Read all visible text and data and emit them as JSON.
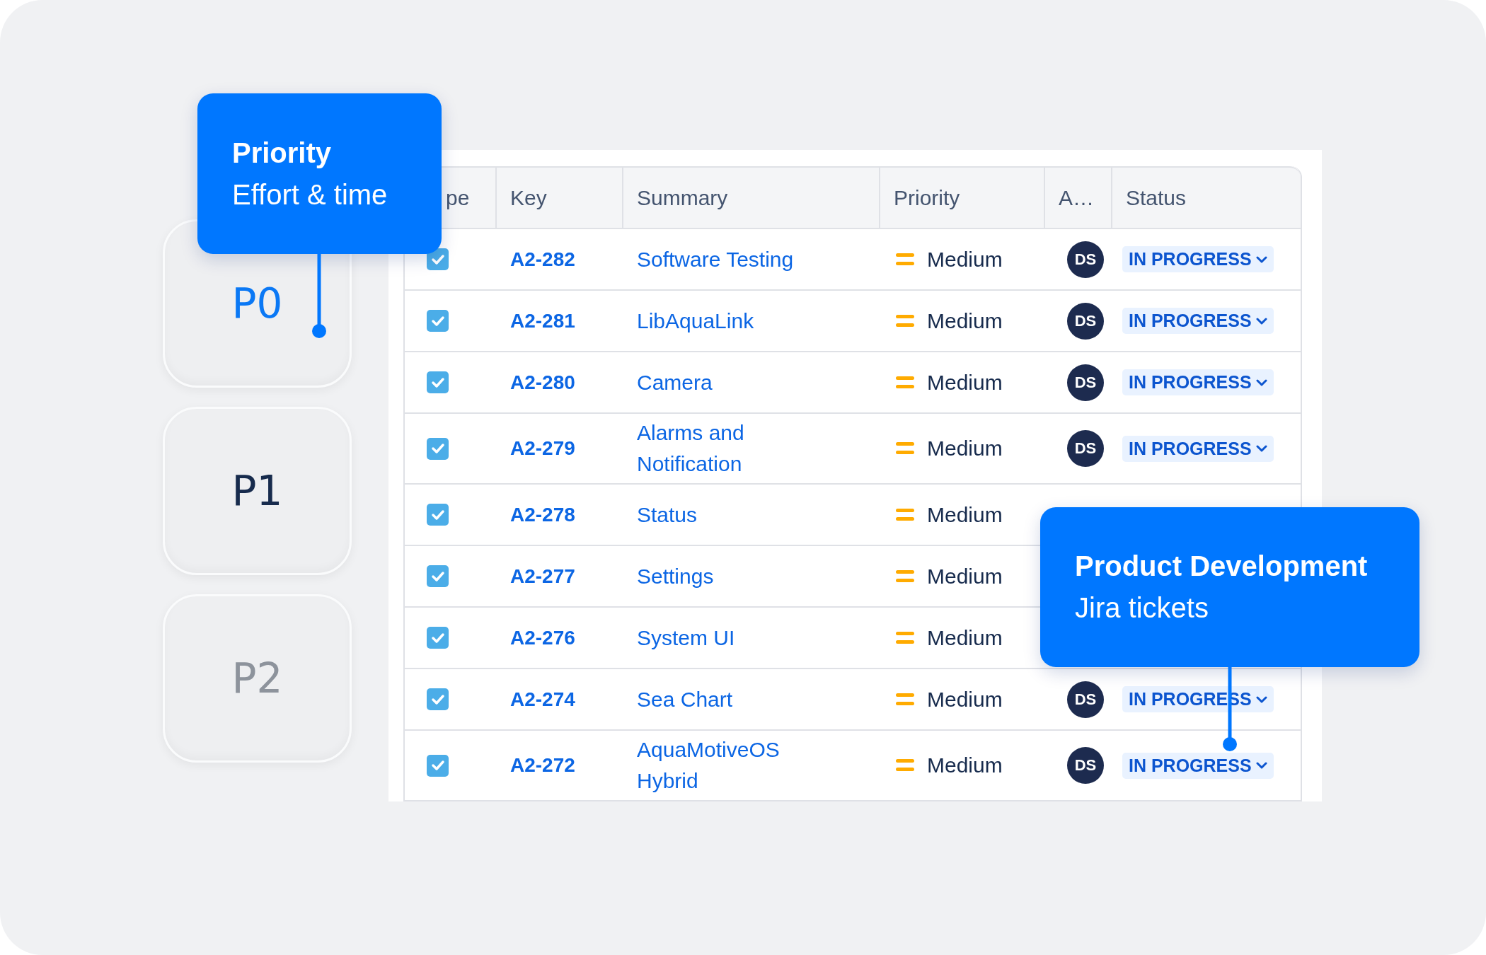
{
  "priority_cards": [
    {
      "label": "P0",
      "color": "#0a78f5"
    },
    {
      "label": "P1",
      "color": "#172b4d"
    },
    {
      "label": "P2",
      "color": "#8d939c"
    }
  ],
  "table": {
    "columns": [
      "pe",
      "Key",
      "Summary",
      "Priority",
      "A…",
      "Status"
    ],
    "rows": [
      {
        "checked": true,
        "key": "A2-282",
        "summary": "Software Testing",
        "priority": "Medium",
        "assignee": "DS",
        "status": "IN PROGRESS"
      },
      {
        "checked": true,
        "key": "A2-281",
        "summary": "LibAquaLink",
        "priority": "Medium",
        "assignee": "DS",
        "status": "IN PROGRESS"
      },
      {
        "checked": true,
        "key": "A2-280",
        "summary": "Camera",
        "priority": "Medium",
        "assignee": "DS",
        "status": "IN PROGRESS"
      },
      {
        "checked": true,
        "key": "A2-279",
        "summary": "Alarms and Notification",
        "priority": "Medium",
        "assignee": "DS",
        "status": "IN PROGRESS"
      },
      {
        "checked": true,
        "key": "A2-278",
        "summary": "Status",
        "priority": "Medium"
      },
      {
        "checked": true,
        "key": "A2-277",
        "summary": "Settings",
        "priority": "Medium"
      },
      {
        "checked": true,
        "key": "A2-276",
        "summary": "System UI",
        "priority": "Medium"
      },
      {
        "checked": true,
        "key": "A2-274",
        "summary": "Sea Chart",
        "priority": "Medium",
        "assignee": "DS",
        "status": "IN PROGRESS"
      },
      {
        "checked": true,
        "key": "A2-272",
        "summary": "AquaMotiveOS Hybrid",
        "priority": "Medium",
        "assignee": "DS",
        "status": "IN PROGRESS"
      }
    ]
  },
  "callouts": [
    {
      "title": "Priority",
      "subtitle": "Effort & time"
    },
    {
      "title": "Product Development",
      "subtitle": "Jira tickets"
    }
  ]
}
